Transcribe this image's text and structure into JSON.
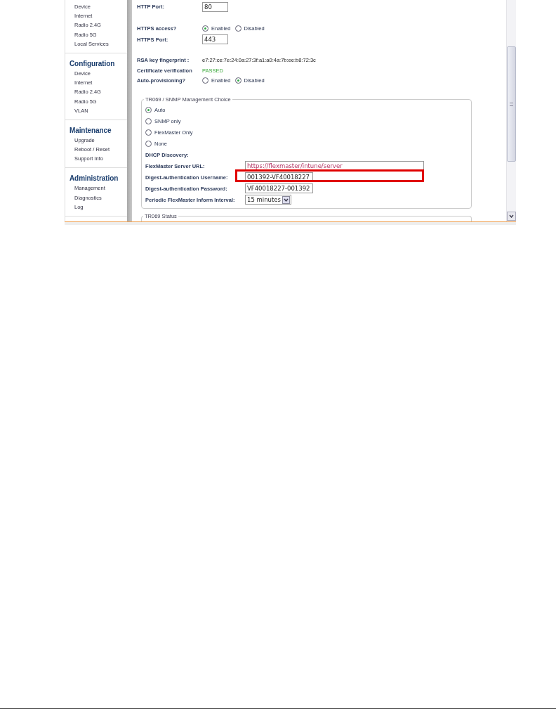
{
  "sidebar": {
    "sections": [
      {
        "items": [
          "Device",
          "Internet",
          "Radio 2.4G",
          "Radio 5G",
          "Local Services"
        ]
      },
      {
        "title": "Configuration",
        "items": [
          "Device",
          "Internet",
          "Radio 2.4G",
          "Radio 5G",
          "VLAN"
        ]
      },
      {
        "title": "Maintenance",
        "items": [
          "Upgrade",
          "Reboot / Reset",
          "Support Info"
        ]
      },
      {
        "title": "Administration",
        "items": [
          "Management",
          "Diagnostics",
          "Log"
        ]
      }
    ]
  },
  "settings": [
    {
      "kind": "field",
      "label": "HTTP Port:",
      "value": "80"
    },
    {
      "kind": "radio",
      "label": "HTTPS access?",
      "options": [
        {
          "label": "Enabled",
          "selected": true
        },
        {
          "label": "Disabled",
          "selected": false
        }
      ]
    },
    {
      "kind": "field",
      "label": "HTTPS Port:",
      "value": "443"
    },
    {
      "kind": "text",
      "label": "RSA key fingerprint :",
      "value": "e7:27:ce:7e:24:0a:27:3f:a1:a0:4a:7b:ee:b8:72:3c"
    },
    {
      "kind": "status",
      "label": "Certificate verification",
      "value": "PASSED"
    },
    {
      "kind": "radio",
      "label": "Auto-provisioning?",
      "options": [
        {
          "label": "Enabled",
          "selected": false
        },
        {
          "label": "Disabled",
          "selected": true
        }
      ]
    }
  ],
  "management_choice": {
    "legend": "TR069 / SNMP Management Choice",
    "options": [
      {
        "label": "Auto",
        "selected": true
      },
      {
        "label": "SNMP only",
        "selected": false
      },
      {
        "label": "FlexMaster Only",
        "selected": false
      },
      {
        "label": "None",
        "selected": false
      }
    ],
    "dhcp_label": "DHCP Discovery:",
    "fields": [
      {
        "kind": "wide",
        "label": "FlexMaster Server URL:",
        "value": "https://flexmaster/intune/server",
        "highlighted": false
      },
      {
        "kind": "text",
        "label": "Digest-authentication Username:",
        "value": "001392-VF40018227",
        "highlighted": true
      },
      {
        "kind": "text",
        "label": "Digest-authentication Password:",
        "value": "VF40018227-001392",
        "highlighted": false
      },
      {
        "kind": "select",
        "label": "Periodic FlexMaster Inform Interval:",
        "value": "15 minutes",
        "highlighted": false
      }
    ]
  },
  "status_section": {
    "legend": "TR069 Status"
  }
}
